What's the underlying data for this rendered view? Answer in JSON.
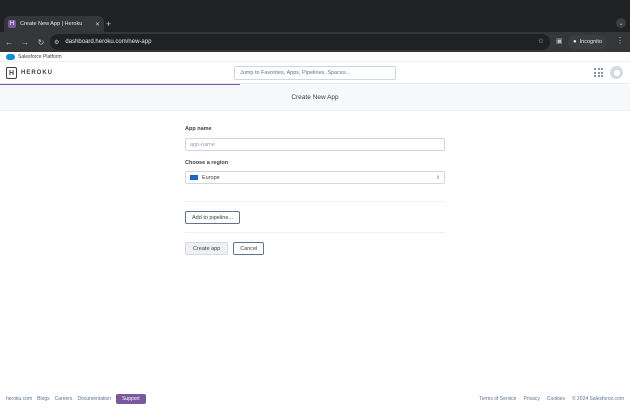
{
  "browser": {
    "tab_title": "Create New App | Heroku",
    "new_tab": "+",
    "url": "dashboard.heroku.com/new-app",
    "incognito_label": "Incognito"
  },
  "salesforce_bar": {
    "label": "Salesforce Platform"
  },
  "header": {
    "logo_text": "HEROKU",
    "logo_mark": "H",
    "search_placeholder": "Jump to Favorites, Apps, Pipelines, Spaces..."
  },
  "page": {
    "title": "Create New App"
  },
  "form": {
    "app_name_label": "App name",
    "app_name_placeholder": "app-name",
    "app_name_value": "",
    "region_label": "Choose a region",
    "region_value": "Europe",
    "pipeline_button": "Add to pipeline...",
    "create_button": "Create app",
    "cancel_button": "Cancel"
  },
  "footer": {
    "links": [
      "heroku.com",
      "Blogs",
      "Careers",
      "Documentation"
    ],
    "support_button": "Support",
    "right_links": [
      "Terms of Service",
      "Privacy",
      "Cookies"
    ],
    "copyright": "© 2024 Salesforce.com"
  },
  "colors": {
    "accent": "#79589f",
    "chrome_dark": "#202124",
    "text": "#3f3f44",
    "muted": "#62738d"
  },
  "icons": [
    "back-icon",
    "forward-icon",
    "reload-icon",
    "site-info-icon",
    "star-icon",
    "sidepanel-icon",
    "incognito-icon",
    "more-icon",
    "apps-grid-icon",
    "avatar-icon",
    "region-flag-icon",
    "chevron-updown-icon"
  ]
}
